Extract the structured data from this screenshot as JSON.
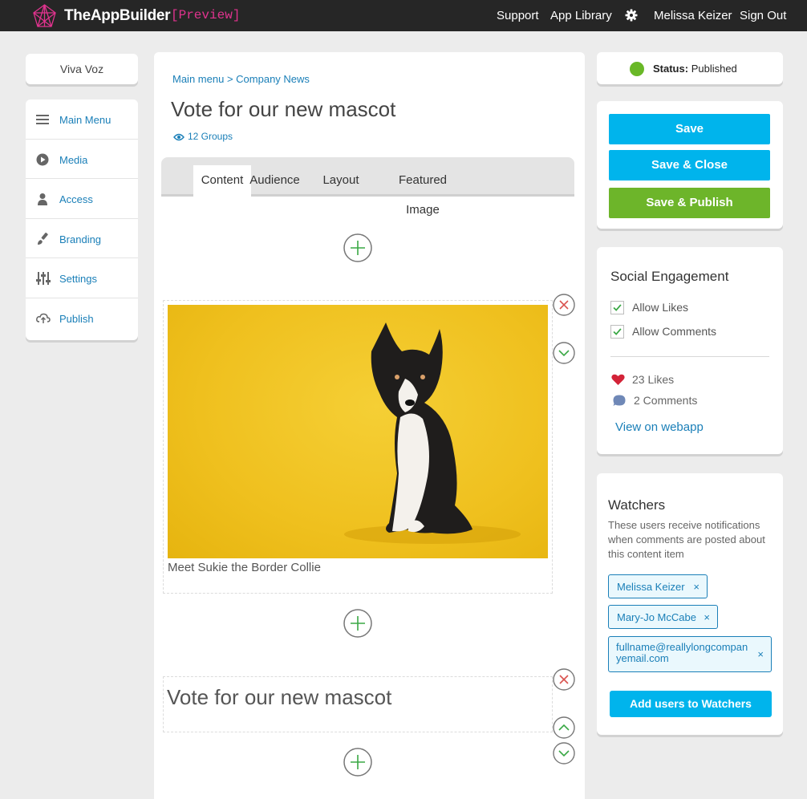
{
  "topbar": {
    "brand": "TheAppBuilder",
    "preview_tag": "[Preview]",
    "links": [
      "Support",
      "App Library"
    ],
    "settings_icon": "gear-icon",
    "user_name": "Melissa Keizer",
    "sign_out": "Sign Out"
  },
  "sidebar": {
    "app_name": "Viva Voz",
    "items": [
      {
        "label": "Main Menu",
        "icon": "menu-icon"
      },
      {
        "label": "Media",
        "icon": "play-icon"
      },
      {
        "label": "Access",
        "icon": "user-icon"
      },
      {
        "label": "Branding",
        "icon": "brush-icon"
      },
      {
        "label": "Settings",
        "icon": "sliders-icon"
      },
      {
        "label": "Publish",
        "icon": "cloud-upload-icon"
      }
    ]
  },
  "main": {
    "breadcrumb": {
      "parent": "Main menu",
      "separator": ">",
      "current": "Company News"
    },
    "title": "Vote for our new mascot",
    "groups": "12 Groups",
    "tabs": [
      "Content",
      "Audience",
      "Layout",
      "Featured Image"
    ],
    "active_tab": "Content",
    "image_caption": "Meet Sukie the Border Collie",
    "text_block_title": "Vote for our new mascot"
  },
  "status": {
    "label": "Status:",
    "value": "Published",
    "color": "#69b827"
  },
  "actions": {
    "save": "Save",
    "save_close": "Save & Close",
    "save_publish": "Save & Publish"
  },
  "social": {
    "title": "Social Engagement",
    "allow_likes": "Allow Likes",
    "allow_comments": "Allow Comments",
    "likes": "23 Likes",
    "comments": "2 Comments",
    "view_link": "View on webapp"
  },
  "watchers": {
    "title": "Watchers",
    "description": "These users receive notifications when comments are posted about this content item",
    "users": [
      "Melissa Keizer",
      "Mary-Jo McCabe",
      "fullname@reallylongcompanyemail.com"
    ],
    "remove_glyph": "×",
    "add_button": "Add users to Watchers"
  }
}
